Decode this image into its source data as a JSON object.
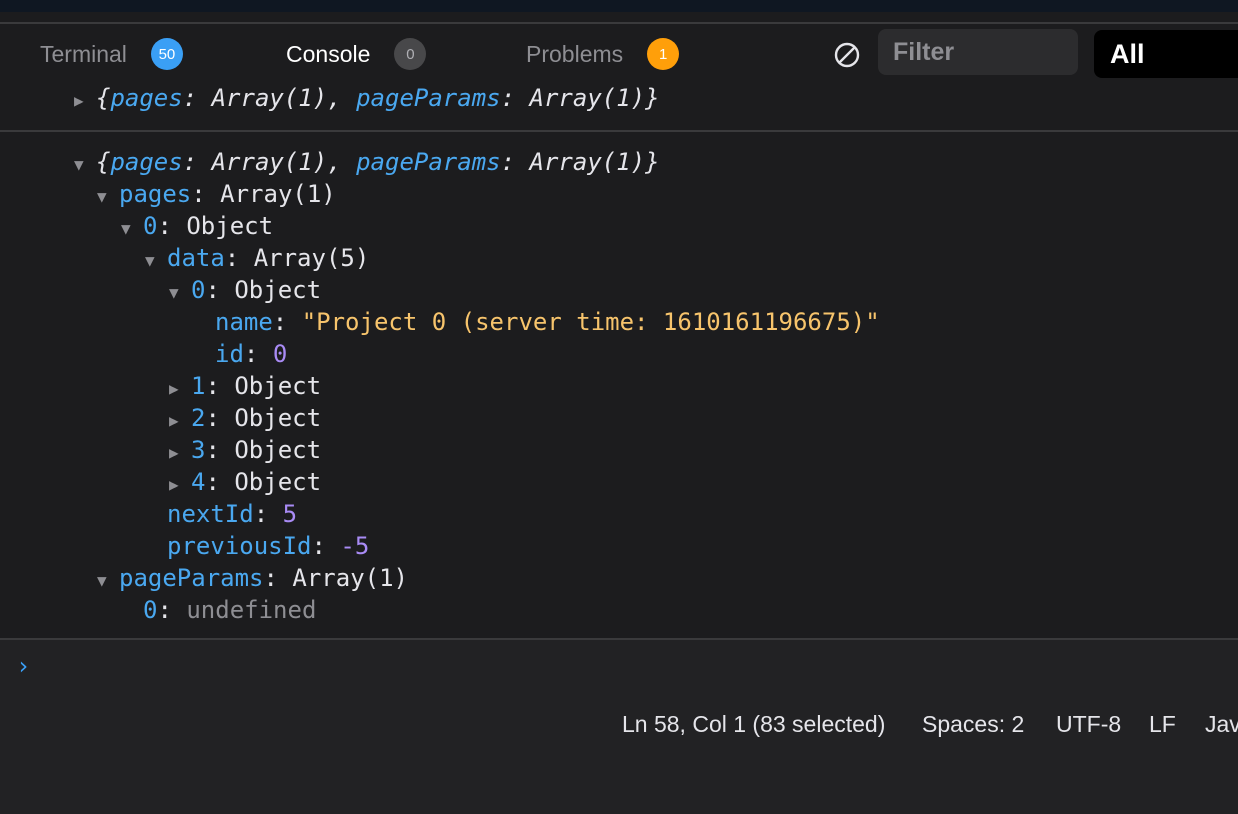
{
  "tabs": [
    {
      "label": "Terminal",
      "count": "50",
      "active": false
    },
    {
      "label": "Console",
      "count": "0",
      "active": true
    },
    {
      "label": "Problems",
      "count": "1",
      "active": false
    }
  ],
  "toolbar": {
    "clear_icon": "clear-console-icon",
    "filter_placeholder": "Filter",
    "level_value": "All"
  },
  "console": {
    "collapsed_entry": {
      "k1": "pages",
      "v1": "Array(1)",
      "k2": "pageParams",
      "v2": "Array(1)"
    },
    "expanded_entry": {
      "summary": {
        "k1": "pages",
        "v1": "Array(1)",
        "k2": "pageParams",
        "v2": "Array(1)"
      },
      "pages_key": "pages",
      "pages_value": "Array(1)",
      "page0_key": "0",
      "page0_value": "Object",
      "data_key": "data",
      "data_value": "Array(5)",
      "item0_key": "0",
      "item0_value": "Object",
      "name_key": "name",
      "name_value": "\"Project 0 (server time: 1610161196675)\"",
      "id_key": "id",
      "id_value": "0",
      "items": [
        {
          "key": "1",
          "value": "Object"
        },
        {
          "key": "2",
          "value": "Object"
        },
        {
          "key": "3",
          "value": "Object"
        },
        {
          "key": "4",
          "value": "Object"
        }
      ],
      "nextId_key": "nextId",
      "nextId_value": "5",
      "previousId_key": "previousId",
      "previousId_value": "-5",
      "pageParams_key": "pageParams",
      "pageParams_value": "Array(1)",
      "pp0_key": "0",
      "pp0_value": "undefined"
    }
  },
  "prompt_symbol": "›",
  "statusbar": {
    "position": "Ln 58, Col 1 (83 selected)",
    "indent": "Spaces: 2",
    "encoding": "UTF-8",
    "eol": "LF",
    "language": "Jav"
  },
  "colors": {
    "background": "#1c1c1e",
    "key": "#4aa8f0",
    "string": "#f7c46c",
    "number": "#a98bf5",
    "badge_terminal": "#3a9ff5",
    "badge_problems": "#ff9f0a"
  }
}
